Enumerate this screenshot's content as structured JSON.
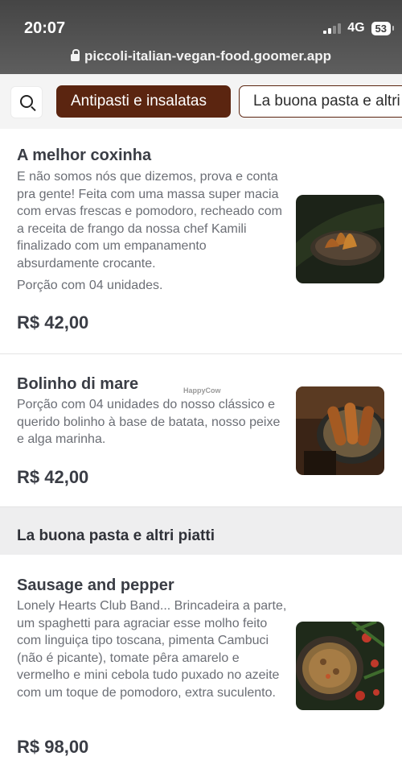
{
  "status_bar": {
    "time": "20:07",
    "network": "4G",
    "battery": "53"
  },
  "browser": {
    "url": "piccoli-italian-vegan-food.goomer.app"
  },
  "category_tabs": [
    {
      "label": "Antipasti e insalatas",
      "active": true
    },
    {
      "label": "La buona pasta e altri piatti",
      "active": false
    }
  ],
  "products": [
    {
      "title": "A melhor coxinha",
      "description": "E não somos nós que dizemos, prova e conta pra gente! Feita com uma massa super macia com ervas frescas e pomodoro, recheado com a receita de frango da nossa chef Kamili finalizado com um empanamento absurdamente crocante.",
      "note": "Porção com 04 unidades.",
      "price": "R$ 42,00"
    },
    {
      "title": "Bolinho di mare",
      "description": "Porção com 04 unidades do nosso clássico e querido bolinho à base de batata, nosso peixe e alga marinha.",
      "price": "R$ 42,00"
    }
  ],
  "section": {
    "title": "La buona pasta e altri piatti"
  },
  "pasta_products": [
    {
      "title": "Sausage and pepper",
      "description": "Lonely Hearts Club Band... Brincadeira a parte, um spaghetti para agraciar esse molho feito com linguiça tipo toscana, pimenta Cambuci (não é picante), tomate pêra amarelo e vermelho e mini cebola tudo puxado no azeite com um toque de pomodoro, extra suculento.",
      "price": "R$ 98,00"
    }
  ],
  "watermark": "HappyCow",
  "colors": {
    "accent": "#5b2510",
    "text": "#3a3d45",
    "muted": "#6b6e75"
  }
}
